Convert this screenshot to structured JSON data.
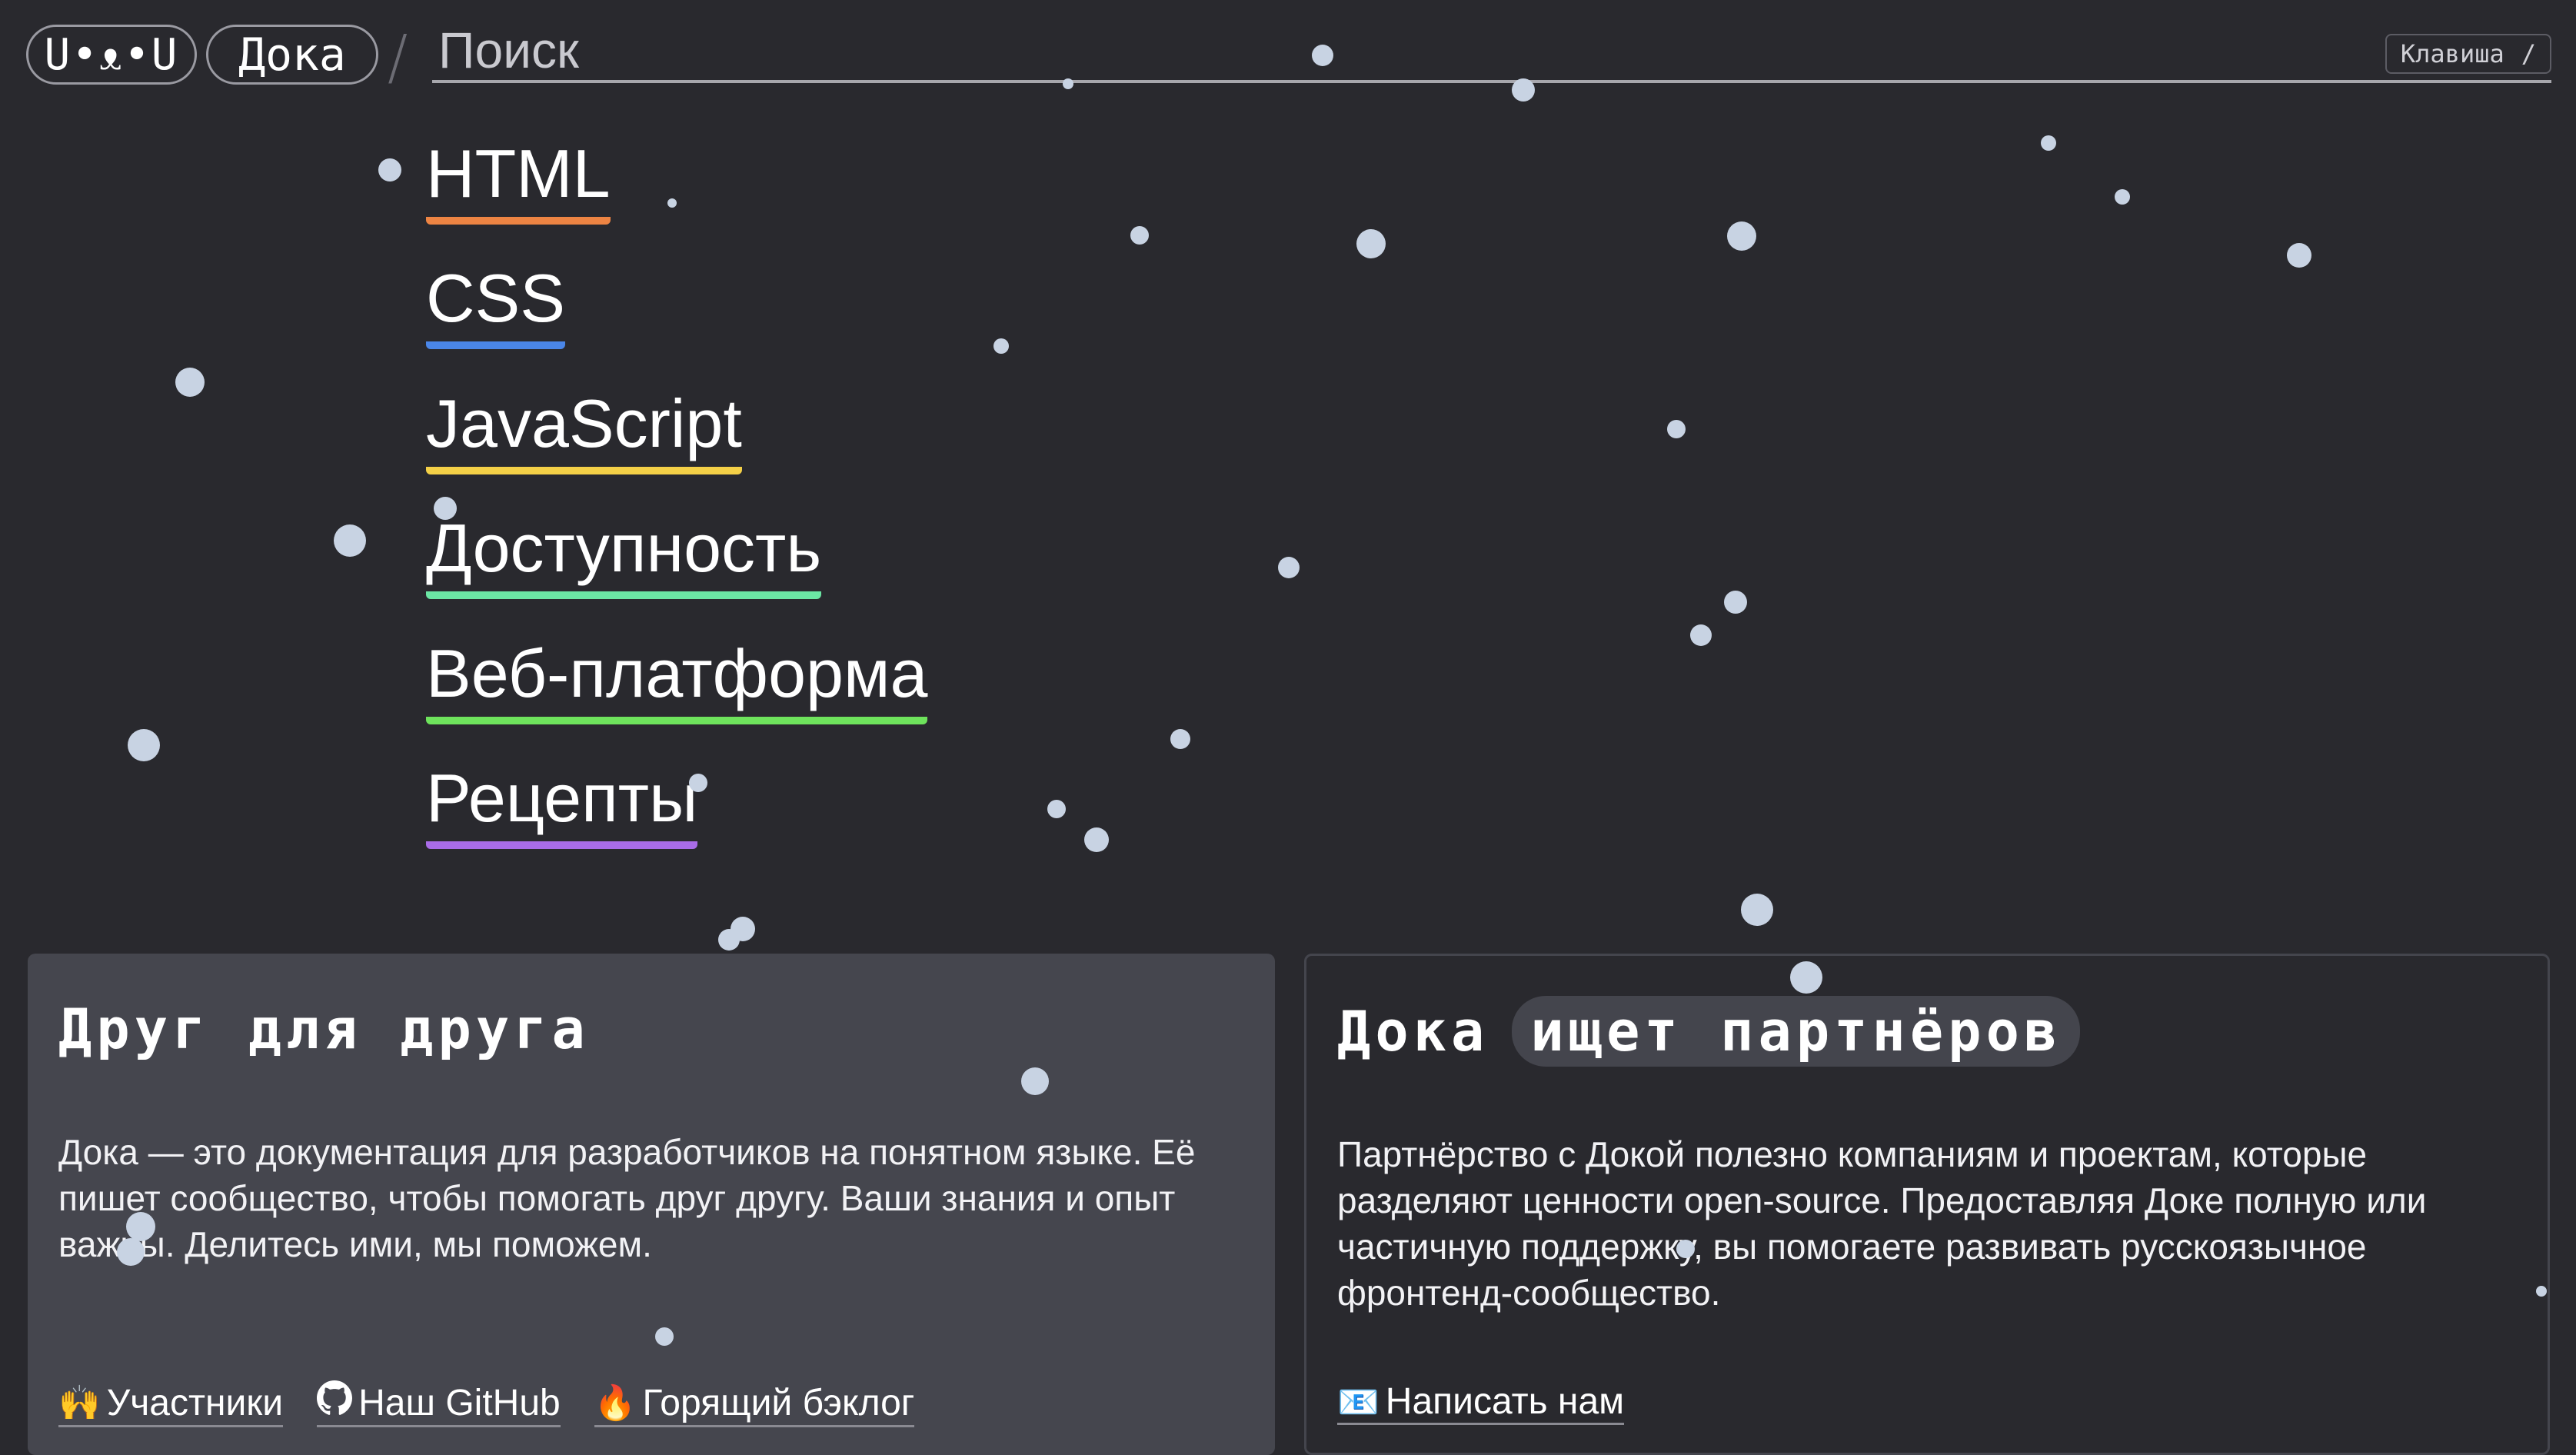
{
  "header": {
    "logo_text": "U•ᴥ•U",
    "doka_label": "Дока",
    "separator": "/",
    "search_placeholder": "Поиск",
    "key_hint_label": "Клавиша",
    "key_hint_key": "/"
  },
  "nav": [
    {
      "label": "HTML",
      "color": "#ed8443"
    },
    {
      "label": "CSS",
      "color": "#4a86e8"
    },
    {
      "label": "JavaScript",
      "color": "#f4d047"
    },
    {
      "label": "Доступность",
      "color": "#6be6a4"
    },
    {
      "label": "Веб-платформа",
      "color": "#6ee35c"
    },
    {
      "label": "Рецепты",
      "color": "#a96ce8"
    }
  ],
  "card_left": {
    "title": "Друг для друга",
    "text": "Дока — это документация для разработчиков на понятном языке. Её пишет сообщество, чтобы помогать друг другу. Ваши знания и опыт важны. Делитесь ими, мы поможем.",
    "links": [
      {
        "icon": "🙌",
        "label": "Участники"
      },
      {
        "icon": "github-icon",
        "label": "Наш GitHub"
      },
      {
        "icon": "🔥",
        "label": "Горящий бэклог"
      }
    ]
  },
  "card_right": {
    "title_plain": "Дока",
    "title_highlight": "ищет партнёров",
    "text": "Партнёрство с Докой полезно компаниям и проектам, которые разделяют ценности open-source. Предоставляя Доке полную или частичную поддержку, вы помогаете развивать русскоязычное фронтенд-сообщество.",
    "link": {
      "icon": "📧",
      "label": "Написать нам"
    }
  },
  "colors": {
    "background": "#29292e",
    "card": "#45464e",
    "snow": "#c8d3e3"
  }
}
